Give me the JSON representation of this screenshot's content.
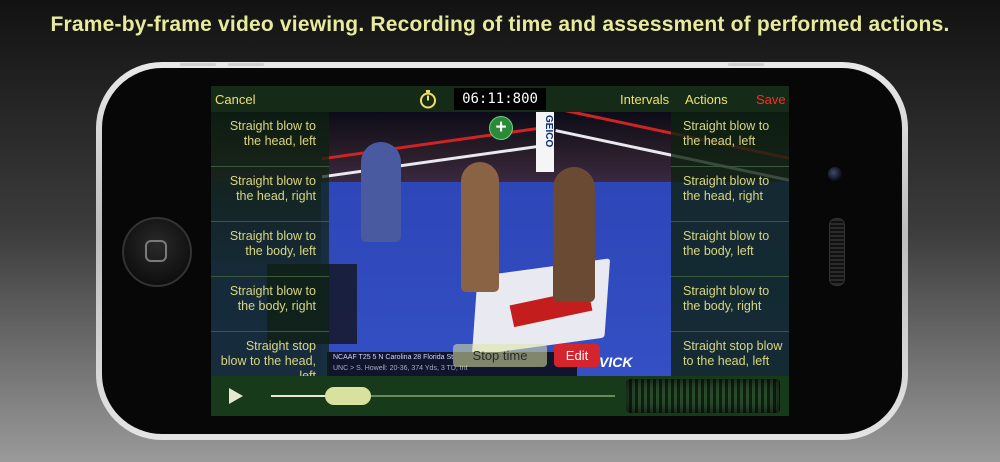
{
  "headline": "Frame-by-frame video viewing. Recording of time and assessment of performed actions.",
  "topbar": {
    "cancel": "Cancel",
    "timer": "06:11:800",
    "intervals": "Intervals",
    "actions": "Actions",
    "save": "Save"
  },
  "left_actions": [
    {
      "label": "Straight blow to the head, left"
    },
    {
      "label": "Straight blow to the head, right"
    },
    {
      "label": "Straight blow to the body, left"
    },
    {
      "label": "Straight blow to the body, right"
    },
    {
      "label": "Straight stop blow to the head, left"
    }
  ],
  "right_actions": [
    {
      "label": "Straight blow to the head, left"
    },
    {
      "label": "Straight blow to the head, right"
    },
    {
      "label": "Straight blow to the body, left"
    },
    {
      "label": "Straight blow to the body, right"
    },
    {
      "label": "Straight stop blow to the head, left"
    }
  ],
  "buttons": {
    "stop_time": "Stop time",
    "edit": "Edit"
  },
  "video": {
    "geico": "GEICO",
    "scorebug_row1": "NCAAF T25   5 N Carolina   28   Florida St",
    "scorebug_row2": "UNC  >  S. Howell: 20-36, 374 Yds, 3 TD, Int",
    "vick": "VICK"
  },
  "player": {
    "progress": 0.2
  },
  "colors": {
    "action_text": "#d8d67e",
    "save": "#ff2a2a",
    "edit_bg": "#d4242d",
    "headline": "#e8ec9a"
  },
  "icons": [
    "stopwatch-icon",
    "add-icon",
    "play-icon"
  ]
}
